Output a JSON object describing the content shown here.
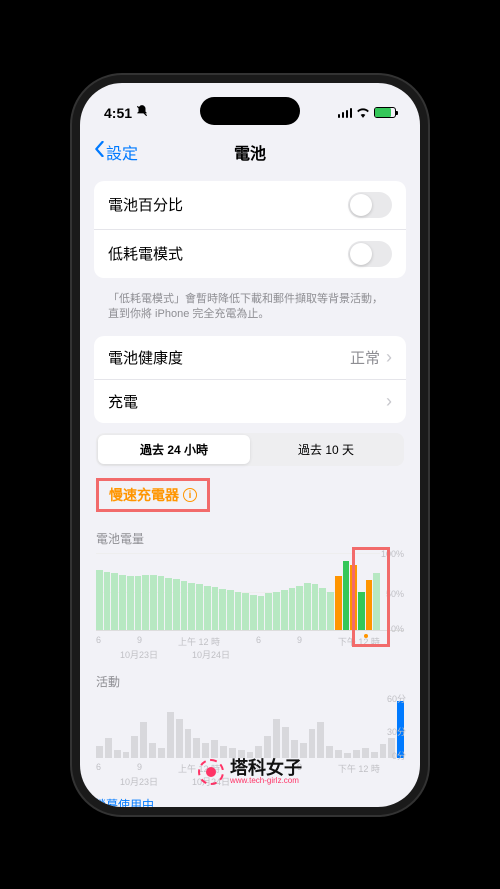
{
  "status": {
    "time": "4:51",
    "silent": true
  },
  "nav": {
    "back_label": "設定",
    "title": "電池"
  },
  "group1": {
    "battery_percentage_label": "電池百分比",
    "low_power_label": "低耗電模式",
    "footer_note": "「低耗電模式」會暫時降低下載和郵件擷取等背景活動，直到你將 iPhone 完全充電為止。"
  },
  "group2": {
    "battery_health_label": "電池健康度",
    "battery_health_value": "正常",
    "charging_label": "充電"
  },
  "segmented": {
    "last_24h": "過去 24 小時",
    "last_10d": "過去 10 天"
  },
  "slow_charger_label": "慢速充電器",
  "battery_level_section_title": "電池電量",
  "activity_section_title": "活動",
  "screen_on_label": "螢幕使用中",
  "chart_data": {
    "type": "bar",
    "xlabel": "",
    "ylabel": "%",
    "ylim": [
      0,
      100
    ],
    "x_ticks": [
      "6",
      "9",
      "上午 12 時",
      "6",
      "9",
      "下午 12 時"
    ],
    "x_dates": [
      "10月23日",
      "10月24日"
    ],
    "values": [
      78,
      76,
      74,
      72,
      70,
      70,
      72,
      72,
      70,
      68,
      66,
      64,
      62,
      60,
      58,
      56,
      54,
      52,
      50,
      48,
      46,
      45,
      48,
      50,
      52,
      55,
      58,
      62,
      60,
      55,
      50,
      70,
      90,
      85,
      50,
      65,
      75
    ],
    "special_bars": {
      "31": "orange",
      "32": "green",
      "33": "orange",
      "34": "green",
      "35": "orange"
    },
    "y_labels": {
      "0": "0%",
      "50": "50%",
      "100": "100%"
    }
  },
  "activity_chart": {
    "type": "bar",
    "ylabel": "分",
    "ylim": [
      0,
      60
    ],
    "y_labels": {
      "0": "0分",
      "30": "30分",
      "60": "60分"
    },
    "values": [
      12,
      20,
      8,
      6,
      22,
      35,
      15,
      10,
      45,
      38,
      28,
      20,
      15,
      18,
      12,
      10,
      8,
      6,
      12,
      22,
      38,
      30,
      18,
      15,
      28,
      35,
      12,
      8,
      5,
      8,
      10,
      6,
      14,
      20,
      55
    ],
    "blue_last": true
  },
  "watermark": {
    "text": "塔科女子",
    "url": "www.tech-girlz.com"
  }
}
